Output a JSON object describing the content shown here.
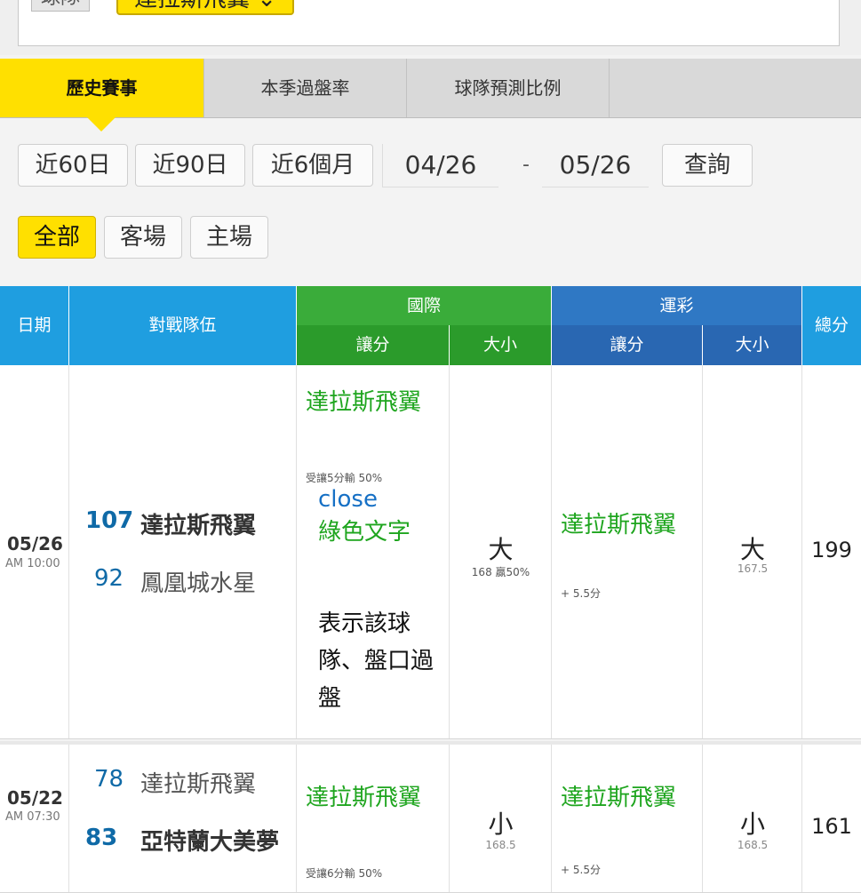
{
  "breadcrumb": {
    "league": "球隊",
    "team": "達拉斯飛翼"
  },
  "tabs": [
    {
      "label": "歷史賽事"
    },
    {
      "label": "本季過盤率"
    },
    {
      "label": "球隊預測比例"
    }
  ],
  "filters": {
    "periods": [
      "近60日",
      "近90日",
      "近6個月"
    ],
    "date_from": "04/26",
    "date_sep": "-",
    "date_to": "05/26",
    "query_label": "查詢",
    "venues": [
      "全部",
      "客場",
      "主場"
    ]
  },
  "table": {
    "headers": {
      "date": "日期",
      "matchup": "對戰隊伍",
      "intl": "國際",
      "lottery": "運彩",
      "handicap": "讓分",
      "ou": "大小",
      "total": "總分"
    },
    "rows": [
      {
        "date": "05/26",
        "time": "AM 10:00",
        "team1_score": "107",
        "team1": "達拉斯飛翼",
        "team2_score": "92",
        "team2": "鳳凰城水星",
        "intl_hc_team": "達拉斯飛翼",
        "intl_hc_note": "受讓5分輸 50%",
        "tooltip_close": "close",
        "tooltip_green": "綠色文字",
        "tooltip_desc": "表示該球隊、盤口過盤",
        "intl_ou": "大",
        "intl_ou_note": "168 贏50%",
        "lot_hc_team": "達拉斯飛翼",
        "lot_hc_note": "+ 5.5分",
        "lot_ou": "大",
        "lot_ou_note": "167.5",
        "total": "199"
      },
      {
        "date": "05/22",
        "time": "AM 07:30",
        "team1_score": "78",
        "team1": "達拉斯飛翼",
        "team2_score": "83",
        "team2": "亞特蘭大美夢",
        "intl_hc_team": "達拉斯飛翼",
        "intl_hc_note": "受讓6分輸 50%",
        "intl_ou": "小",
        "intl_ou_note": "168.5",
        "lot_hc_team": "達拉斯飛翼",
        "lot_hc_note": "+ 5.5分",
        "lot_ou": "小",
        "lot_ou_note": "168.5",
        "total": "161"
      }
    ]
  }
}
